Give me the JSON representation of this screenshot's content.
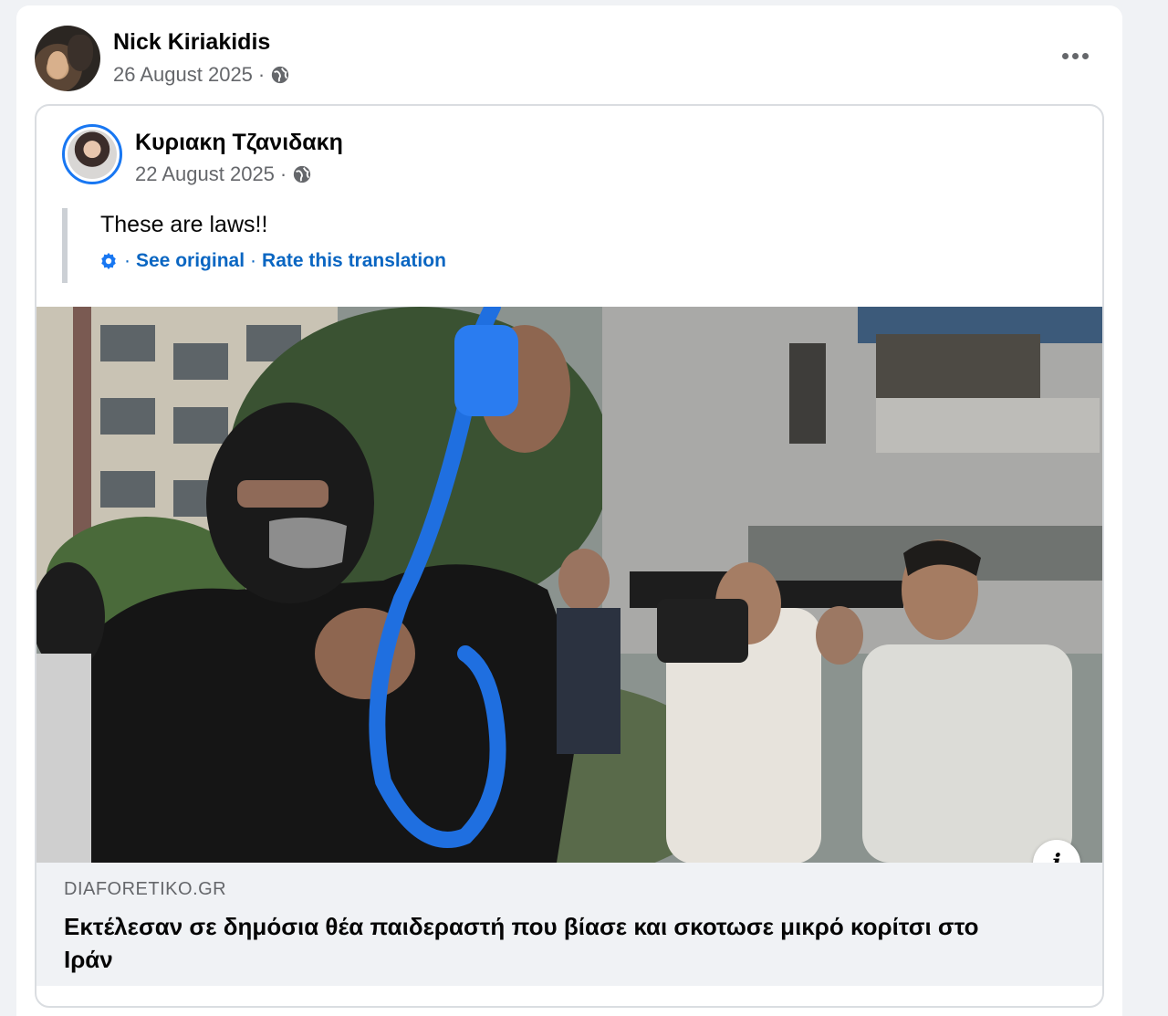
{
  "post": {
    "author": "Nick Kiriakidis",
    "date": "26 August 2025",
    "separator": "·",
    "privacy_icon": "globe-icon",
    "more_icon": "more-dots-icon"
  },
  "shared_post": {
    "author": "Κυριακη Τζανιδακη",
    "date": "22 August 2025",
    "separator": "·",
    "privacy_icon": "globe-icon",
    "text": "These are laws!!",
    "translation": {
      "icon": "gear-icon",
      "sep": "·",
      "see_original": "See original",
      "rate": "Rate this translation"
    },
    "link": {
      "domain": "DIAFORETIKO.GR",
      "title": "Εκτέλεσαν σε δημόσια θέα παιδεραστή που βίασε και σκοτωσε μικρό κορίτσι στο Ιράν",
      "info_icon": "info-icon",
      "info_label": "i"
    }
  },
  "colors": {
    "link_blue": "#0a66c2",
    "meta_gray": "#65676b",
    "footer_bg": "#f0f2f5",
    "avatar_ring": "#1877f2",
    "rope_blue": "#1f6fe0"
  }
}
